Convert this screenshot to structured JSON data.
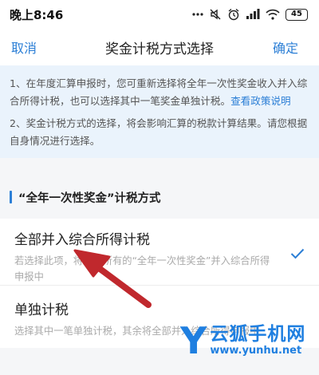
{
  "status_bar": {
    "time": "晚上8:46",
    "battery": "45",
    "icons": [
      "dots-icon",
      "mute-icon",
      "alarm-icon",
      "cellular-icon",
      "wifi-icon",
      "battery-icon"
    ]
  },
  "nav": {
    "cancel_label": "取消",
    "title": "奖金计税方式选择",
    "confirm_label": "确定"
  },
  "notice": {
    "item1_text": "1、在年度汇算申报时，您可重新选择将全年一次性奖金收入并入综合所得计税，也可以选择其中一笔奖金单独计税。",
    "item1_link": "查看政策说明",
    "item2_text": "2、奖金计税方式的选择，将会影响汇算的税款计算结果。请您根据自身情况进行选择。"
  },
  "section": {
    "title": "“全年一次性奖金”计税方式"
  },
  "options": [
    {
      "title": "全部并入综合所得计税",
      "description": "若选择此项，将会把所有的“全年一次性奖金”并入综合所得申报中",
      "selected": true
    },
    {
      "title": "单独计税",
      "description": "选择其中一笔单独计税，其余将全部并入综合所得申报中",
      "selected": false
    }
  ],
  "watermark": {
    "logo_letter": "Y",
    "name": "云狐手机网",
    "url": "www.yunhu.net"
  },
  "colors": {
    "accent": "#2c7fd6",
    "notice_bg": "#eaf3fc",
    "annotation_arrow": "#c0282d",
    "watermark": "#1f7fe0"
  }
}
